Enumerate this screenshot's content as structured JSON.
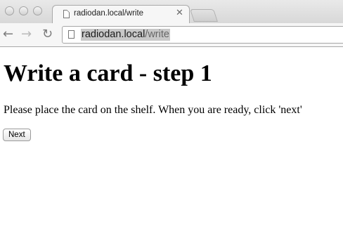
{
  "browser": {
    "tab": {
      "title": "radiodan.local/write",
      "close_glyph": "✕"
    },
    "toolbar": {
      "back_glyph": "←",
      "forward_glyph": "→",
      "reload_glyph": "↻"
    },
    "address": {
      "host": "radiodan.local",
      "path": "/write"
    }
  },
  "page": {
    "heading": "Write a card - step 1",
    "instructions": "Please place the card on the shelf. When you are ready, click 'next'",
    "next_label": "Next"
  }
}
